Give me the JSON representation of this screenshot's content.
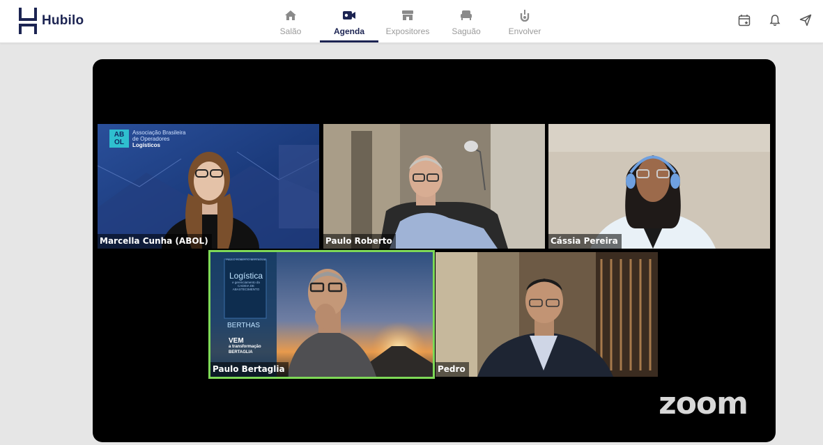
{
  "brand": {
    "name": "Hubilo",
    "color": "#1c2452"
  },
  "nav": {
    "items": [
      {
        "label": "Salão",
        "icon": "home-icon",
        "active": false
      },
      {
        "label": "Agenda",
        "icon": "video-camera-icon",
        "active": true
      },
      {
        "label": "Expositores",
        "icon": "store-icon",
        "active": false
      },
      {
        "label": "Saguão",
        "icon": "lounge-chair-icon",
        "active": false
      },
      {
        "label": "Envolver",
        "icon": "engage-icon",
        "active": false
      }
    ]
  },
  "header_actions": [
    "calendar-star-icon",
    "bell-icon",
    "send-icon"
  ],
  "video_call": {
    "app": "zoom",
    "participants": [
      {
        "name": "Marcella Cunha (ABOL)",
        "speaking": false
      },
      {
        "name": "Paulo Roberto",
        "speaking": false
      },
      {
        "name": "Cássia Pereira",
        "speaking": false
      },
      {
        "name": "Paulo Bertaglia",
        "speaking": true
      },
      {
        "name": "Pedro",
        "speaking": false
      }
    ],
    "abol_banner": {
      "badge_top": "AB",
      "badge_bottom": "OL",
      "line1": "Associação Brasileira",
      "line2": "de Operadores",
      "line3": "Logísticos"
    },
    "book": {
      "author": "PAULO ROBERTO BERTAGLIA",
      "title": "Logística",
      "subtitle": "e gerenciamento da",
      "subtitle2": "CADEIA DE ABASTECIMENTO",
      "brand": "BERTHAS",
      "slogan_line1": "VEM",
      "slogan_line2": "a transformação",
      "slogan_line3": "BERTAGLIA"
    },
    "speaker_highlight": "#7ed957"
  }
}
